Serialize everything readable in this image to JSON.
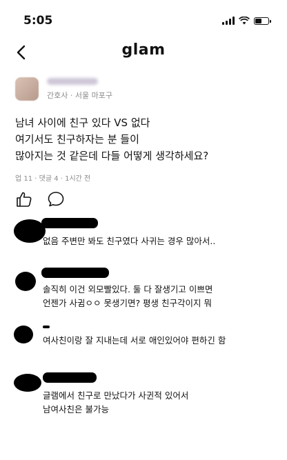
{
  "status_bar": {
    "time": "5:05"
  },
  "nav": {
    "brand": "glam"
  },
  "author": {
    "meta": "간호사 · 서울 마포구"
  },
  "post": {
    "title": "남녀 사이에 친구 있다 VS 없다",
    "body_lines": [
      "여기서도 친구하자는 분 들이",
      "많아지는 것 같은데 다들 어떻게 생각하세요?"
    ],
    "stats": "업 11 · 댓글 4 · 1시간 전"
  },
  "actions": {
    "like_icon": "thumbs-up-icon",
    "comment_icon": "speech-bubble-icon"
  },
  "comments": [
    {
      "lines": [
        "없음 주변만 봐도 친구였다 사귀는 경우 많아서.."
      ]
    },
    {
      "lines": [
        "솔직히 이건 외모빨있다. 둘 다 잘생기고 이쁘면",
        "언젠가 사귐ㅇㅇ 못생기면? 평생 친구각이지 뭐"
      ]
    },
    {
      "lines": [
        "여사친이랑 잘 지내는데 서로 애인있어야 편하긴 함"
      ]
    },
    {
      "lines": [
        "글램에서 친구로 만났다가 사귄적 있어서",
        "남여사친은 불가능"
      ]
    }
  ]
}
